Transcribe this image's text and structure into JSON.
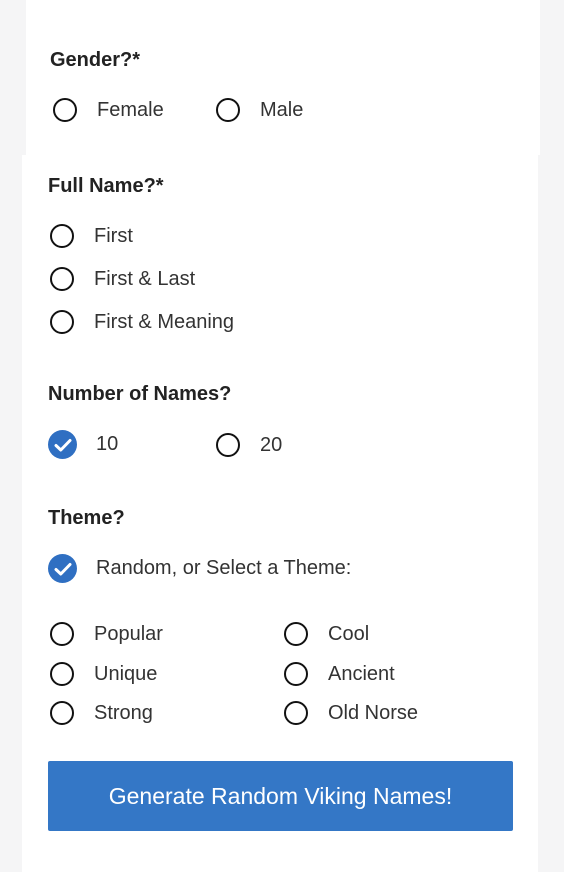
{
  "gender": {
    "label": "Gender?*",
    "options": [
      {
        "label": "Female",
        "checked": false
      },
      {
        "label": "Male",
        "checked": false
      }
    ]
  },
  "full_name": {
    "label": "Full Name?*",
    "options": [
      {
        "label": "First",
        "checked": false
      },
      {
        "label": "First & Last",
        "checked": false
      },
      {
        "label": "First & Meaning",
        "checked": false
      }
    ]
  },
  "number_of_names": {
    "label": "Number of Names?",
    "options": [
      {
        "label": "10",
        "checked": true
      },
      {
        "label": "20",
        "checked": false
      }
    ]
  },
  "theme": {
    "label": "Theme?",
    "random_option": {
      "label": "Random, or Select a Theme:",
      "checked": true
    },
    "options": [
      {
        "label": "Popular",
        "checked": false
      },
      {
        "label": "Cool",
        "checked": false
      },
      {
        "label": "Unique",
        "checked": false
      },
      {
        "label": "Ancient",
        "checked": false
      },
      {
        "label": "Strong",
        "checked": false
      },
      {
        "label": "Old Norse",
        "checked": false
      }
    ]
  },
  "generate_button": {
    "label": "Generate Random Viking Names!"
  },
  "colors": {
    "accent": "#3477c6",
    "checked": "#2f6fc2"
  }
}
